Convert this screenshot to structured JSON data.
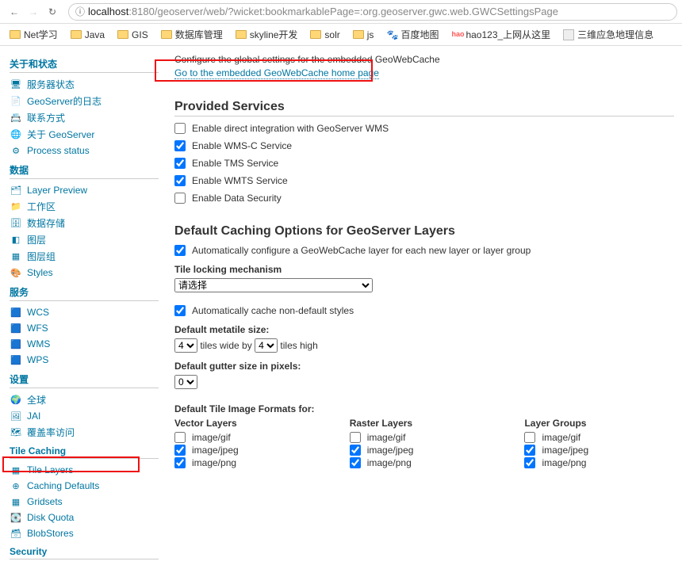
{
  "browser": {
    "url_host": "localhost",
    "url_port": ":8180",
    "url_path": "/geoserver/web/?wicket:bookmarkablePage=:org.geoserver.gwc.web.GWCSettingsPage"
  },
  "bookmarks": [
    "Net学习",
    "Java",
    "GIS",
    "数据库管理",
    "skyline开发",
    "solr",
    "js",
    "百度地图",
    "hao123_上网从这里",
    "三维应急地理信息"
  ],
  "sidebar": {
    "about": {
      "title": "关于和状态",
      "items": [
        "服务器状态",
        "GeoServer的日志",
        "联系方式",
        "关于 GeoServer",
        "Process status"
      ]
    },
    "data": {
      "title": "数据",
      "items": [
        "Layer Preview",
        "工作区",
        "数据存储",
        "图层",
        "图层组",
        "Styles"
      ]
    },
    "services": {
      "title": "服务",
      "items": [
        "WCS",
        "WFS",
        "WMS",
        "WPS"
      ]
    },
    "settings": {
      "title": "设置",
      "items": [
        "全球",
        "JAI",
        "覆盖率访问"
      ]
    },
    "tilecaching": {
      "title": "Tile Caching",
      "items": [
        "Tile Layers",
        "Caching Defaults",
        "Gridsets",
        "Disk Quota",
        "BlobStores"
      ]
    },
    "security": {
      "title": "Security"
    }
  },
  "main": {
    "configure_line": "Configure the global settings for the embedded GeoWebCache",
    "gwc_link": "Go to the embedded GeoWebCache home page",
    "provided_services": {
      "title": "Provided Services",
      "opts": [
        {
          "label": "Enable direct integration with GeoServer WMS",
          "checked": false
        },
        {
          "label": "Enable WMS-C Service",
          "checked": true
        },
        {
          "label": "Enable TMS Service",
          "checked": true
        },
        {
          "label": "Enable WMTS Service",
          "checked": true
        },
        {
          "label": "Enable Data Security",
          "checked": false
        }
      ]
    },
    "defaults": {
      "title": "Default Caching Options for GeoServer Layers",
      "auto_configure": {
        "label": "Automatically configure a GeoWebCache layer for each new layer or layer group",
        "checked": true
      },
      "locking_label": "Tile locking mechanism",
      "locking_value": "请选择",
      "auto_cache": {
        "label": "Automatically cache non-default styles",
        "checked": true
      },
      "metatile_label": "Default metatile size:",
      "metatile_w": "4",
      "metatile_between": "tiles wide by",
      "metatile_h": "4",
      "metatile_after": "tiles high",
      "gutter_label": "Default gutter size in pixels:",
      "gutter_value": "0",
      "formats_title": "Default Tile Image Formats for:",
      "vector": {
        "title": "Vector Layers",
        "gif": false,
        "jpeg": true,
        "png": true
      },
      "raster": {
        "title": "Raster Layers",
        "gif": false,
        "jpeg": true,
        "png": true
      },
      "group": {
        "title": "Layer Groups",
        "gif": false,
        "jpeg": true,
        "png": true
      },
      "f_gif": "image/gif",
      "f_jpeg": "image/jpeg",
      "f_png": "image/png"
    }
  }
}
